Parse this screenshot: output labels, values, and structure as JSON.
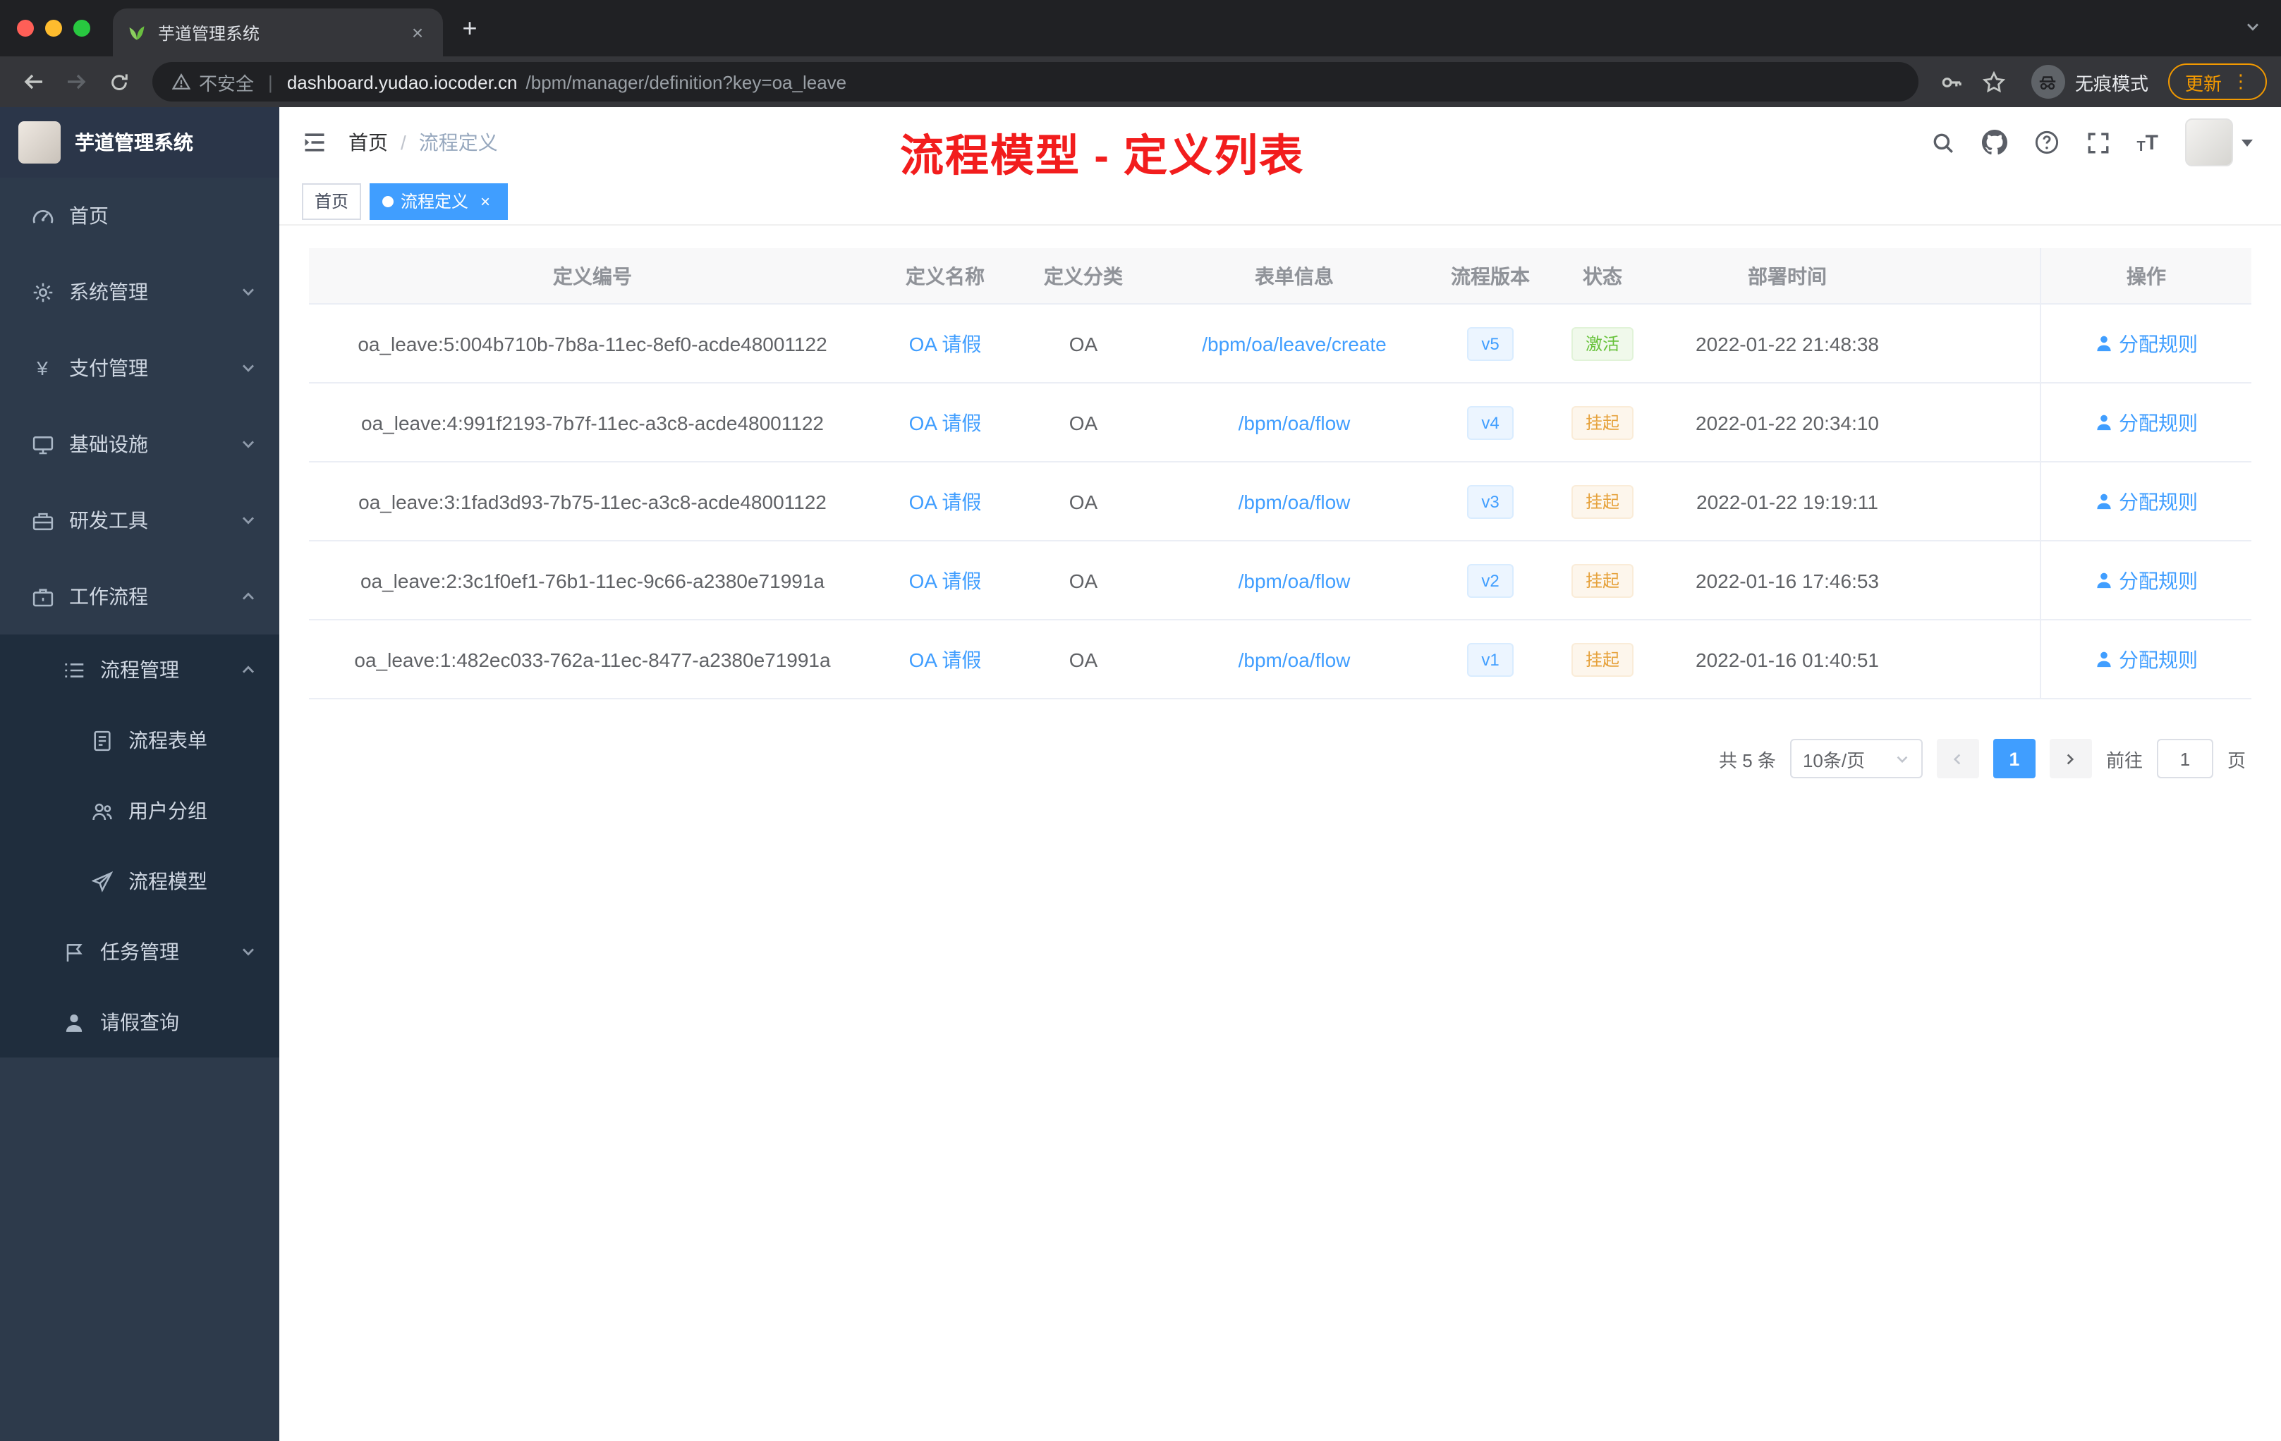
{
  "colors": {
    "accent_blue": "#409eff",
    "success_green": "#67c23a",
    "warning_orange": "#e6a23c",
    "annotation_red": "#f21d1d",
    "sidebar_bg": "#2d3a4b",
    "submenu_bg": "#1f2d3d",
    "chrome_dark": "#202124",
    "toolbar_dark": "#35363a",
    "update_orange": "#f29900"
  },
  "icons": {
    "close": "×",
    "plus": "+",
    "dots": "⋮",
    "yen": "¥"
  },
  "browser": {
    "tab_title": "芋道管理系统",
    "security_label": "不安全",
    "url_sep": "|",
    "url_domain": "dashboard.yudao.iocoder.cn",
    "url_path": "/bpm/manager/definition?key=oa_leave",
    "incognito_label": "无痕模式",
    "update_label": "更新"
  },
  "sidebar": {
    "logo_title": "芋道管理系统",
    "items": [
      {
        "label": "首页"
      },
      {
        "label": "系统管理"
      },
      {
        "label": "支付管理"
      },
      {
        "label": "基础设施"
      },
      {
        "label": "研发工具"
      },
      {
        "label": "工作流程"
      }
    ],
    "process_mgmt": {
      "label": "流程管理",
      "children": [
        {
          "label": "流程表单"
        },
        {
          "label": "用户分组"
        },
        {
          "label": "流程模型"
        }
      ]
    },
    "task_mgmt": {
      "label": "任务管理"
    },
    "leave_query": {
      "label": "请假查询"
    }
  },
  "topbar": {
    "breadcrumb_home": "首页",
    "breadcrumb_sep": "/",
    "breadcrumb_current": "流程定义",
    "annotation": "流程模型 - 定义列表"
  },
  "tags": [
    {
      "label": "首页"
    },
    {
      "label": "流程定义"
    }
  ],
  "table": {
    "headers": [
      "定义编号",
      "定义名称",
      "定义分类",
      "表单信息",
      "流程版本",
      "状态",
      "部署时间",
      "操作"
    ],
    "rows": [
      {
        "id": "oa_leave:5:004b710b-7b8a-11ec-8ef0-acde48001122",
        "name": "OA 请假",
        "category": "OA",
        "form": "/bpm/oa/leave/create",
        "version": "v5",
        "status": "激活",
        "deploy_time": "2022-01-22 21:48:38",
        "action": "分配规则"
      },
      {
        "id": "oa_leave:4:991f2193-7b7f-11ec-a3c8-acde48001122",
        "name": "OA 请假",
        "category": "OA",
        "form": "/bpm/oa/flow",
        "version": "v4",
        "status": "挂起",
        "deploy_time": "2022-01-22 20:34:10",
        "action": "分配规则"
      },
      {
        "id": "oa_leave:3:1fad3d93-7b75-11ec-a3c8-acde48001122",
        "name": "OA 请假",
        "category": "OA",
        "form": "/bpm/oa/flow",
        "version": "v3",
        "status": "挂起",
        "deploy_time": "2022-01-22 19:19:11",
        "action": "分配规则"
      },
      {
        "id": "oa_leave:2:3c1f0ef1-76b1-11ec-9c66-a2380e71991a",
        "name": "OA 请假",
        "category": "OA",
        "form": "/bpm/oa/flow",
        "version": "v2",
        "status": "挂起",
        "deploy_time": "2022-01-16 17:46:53",
        "action": "分配规则"
      },
      {
        "id": "oa_leave:1:482ec033-762a-11ec-8477-a2380e71991a",
        "name": "OA 请假",
        "category": "OA",
        "form": "/bpm/oa/flow",
        "version": "v1",
        "status": "挂起",
        "deploy_time": "2022-01-16 01:40:51",
        "action": "分配规则"
      }
    ]
  },
  "pagination": {
    "total": "共 5 条",
    "page_size": "10条/页",
    "page": "1",
    "goto_label": "前往",
    "goto_page": "1",
    "unit": "页"
  }
}
